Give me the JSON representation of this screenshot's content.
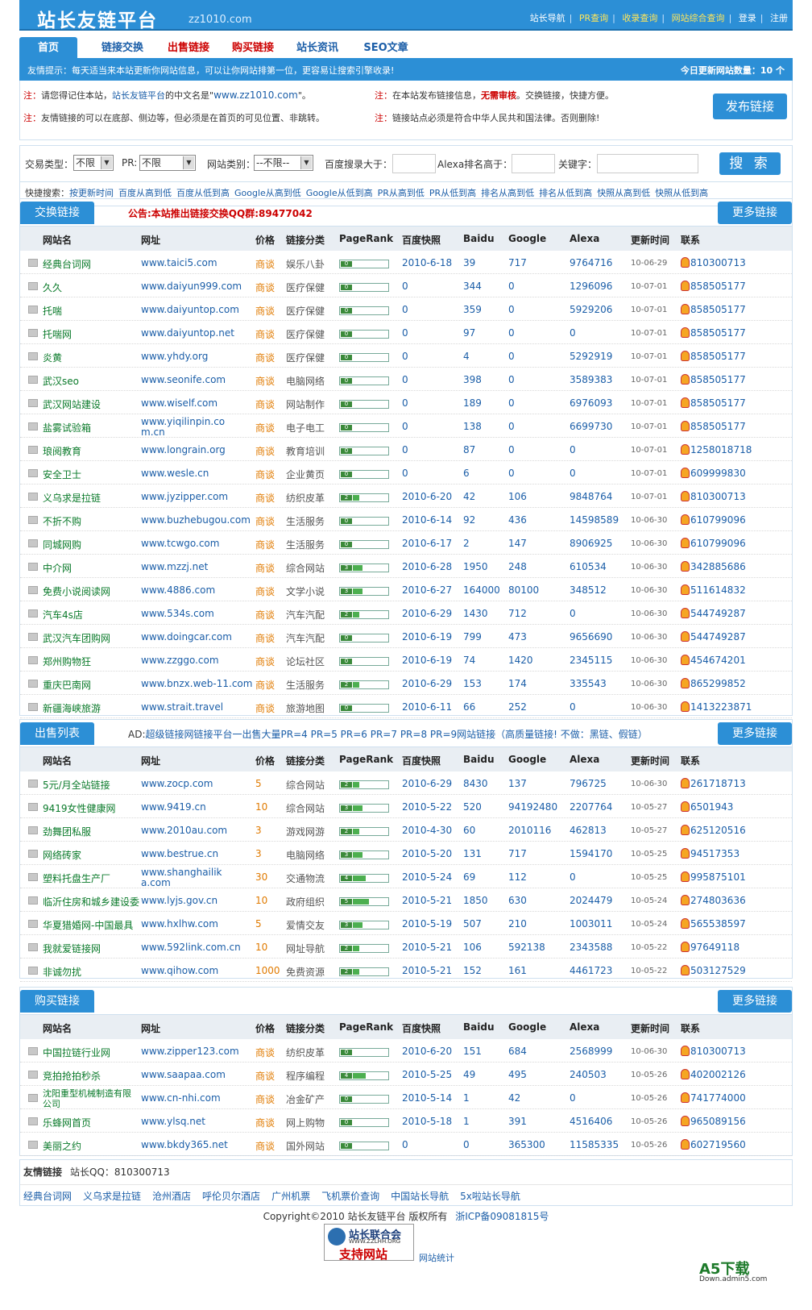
{
  "header": {
    "logo": "站长友链平台",
    "domain": "zz1010.com",
    "links": [
      "站长导航",
      "PR查询",
      "收录查询",
      "网站综合查询",
      "登录",
      "注册"
    ]
  },
  "nav": [
    "首页",
    "链接交换",
    "出售链接",
    "购买链接",
    "站长资讯",
    "SEO文章"
  ],
  "tip": {
    "text": "友情提示：每天适当来本站更新你网站信息，可以让你网站排第一位，更容易让搜索引擎收录!",
    "count": "今日更新网站数量：10 个"
  },
  "notes": {
    "n1a": "注：",
    "n1b": "请您得记住本站，",
    "n1c": "站长友链平台",
    "n1d": "的中文名是\"",
    "n1e": "www.zz1010.com",
    "n1f": "\"。",
    "n2a": "注：",
    "n2b": "友情链接的可以在底部、侧边等，但必须是在首页的可见位置、非跳转。",
    "n3a": "注：",
    "n3b": "在本站发布链接信息，",
    "n3c": "无需审核",
    "n3d": "。交换链接，快捷方便。",
    "n4a": "注：",
    "n4b": "链接站点必须是符合中华人民共和国法律。否则删除!",
    "publish": "发布链接"
  },
  "search": {
    "type_label": "交易类型：",
    "type_val": "不限",
    "pr_label": "PR:",
    "pr_val": "不限",
    "cat_label": "网站类别：",
    "cat_val": "--不限--",
    "baidu_label": "百度搜录大于：",
    "alexa_label": "Alexa排名高于：",
    "kw_label": "关键字：",
    "btn": "搜 索"
  },
  "quick": {
    "label": "快捷搜索：",
    "items": [
      "按更新时间",
      "百度从高到低",
      "百度从低到高",
      "Google从高到低",
      "Google从低到高",
      "PR从高到低",
      "PR从低到高",
      "排名从高到低",
      "排名从低到高",
      "快照从高到低",
      "快照从低到高"
    ]
  },
  "cols": [
    "网站名",
    "网址",
    "价格",
    "链接分类",
    "PageRank",
    "百度快照",
    "Baidu",
    "Google",
    "Alexa",
    "更新时间",
    "联系"
  ],
  "more": "更多链接",
  "exchange": {
    "title": "交换链接",
    "notice": "公告:本站推出链接交换QQ群:89477042",
    "rows": [
      [
        "经典台词网",
        "www.taici5.com",
        "商谈",
        "娱乐八卦",
        "0",
        "2010-6-18",
        "39",
        "717",
        "9764716",
        "10-06-29",
        "810300713"
      ],
      [
        "久久",
        "www.daiyun999.com",
        "商谈",
        "医疗保健",
        "0",
        "0",
        "344",
        "0",
        "1296096",
        "10-07-01",
        "858505177"
      ],
      [
        "托喘",
        "www.daiyuntop.com",
        "商谈",
        "医疗保健",
        "0",
        "0",
        "359",
        "0",
        "5929206",
        "10-07-01",
        "858505177"
      ],
      [
        "托喘网",
        "www.daiyuntop.net",
        "商谈",
        "医疗保健",
        "0",
        "0",
        "97",
        "0",
        "0",
        "10-07-01",
        "858505177"
      ],
      [
        "炎黄",
        "www.yhdy.org",
        "商谈",
        "医疗保健",
        "0",
        "0",
        "4",
        "0",
        "5292919",
        "10-07-01",
        "858505177"
      ],
      [
        "武汉seo",
        "www.seonife.com",
        "商谈",
        "电脑网络",
        "0",
        "0",
        "398",
        "0",
        "3589383",
        "10-07-01",
        "858505177"
      ],
      [
        "武汉网站建设",
        "www.wiself.com",
        "商谈",
        "网站制作",
        "0",
        "0",
        "189",
        "0",
        "6976093",
        "10-07-01",
        "858505177"
      ],
      [
        "盐雾试验箱",
        "www.yiqilinpin.com.cn",
        "商谈",
        "电子电工",
        "0",
        "0",
        "138",
        "0",
        "6699730",
        "10-07-01",
        "858505177"
      ],
      [
        "琅阅教育",
        "www.longrain.org",
        "商谈",
        "教育培训",
        "0",
        "0",
        "87",
        "0",
        "0",
        "10-07-01",
        "1258018718"
      ],
      [
        "安全卫士",
        "www.wesle.cn",
        "商谈",
        "企业黄页",
        "0",
        "0",
        "6",
        "0",
        "0",
        "10-07-01",
        "609999830"
      ],
      [
        "义乌求是拉链",
        "www.jyzipper.com",
        "商谈",
        "纺织皮革",
        "2",
        "2010-6-20",
        "42",
        "106",
        "9848764",
        "10-07-01",
        "810300713"
      ],
      [
        "不折不购",
        "www.buzhebugou.com",
        "商谈",
        "生活服务",
        "0",
        "2010-6-14",
        "92",
        "436",
        "14598589",
        "10-06-30",
        "610799096"
      ],
      [
        "同城网购",
        "www.tcwgo.com",
        "商谈",
        "生活服务",
        "0",
        "2010-6-17",
        "2",
        "147",
        "8906925",
        "10-06-30",
        "610799096"
      ],
      [
        "中介网",
        "www.mzzj.net",
        "商谈",
        "综合网站",
        "3",
        "2010-6-28",
        "1950",
        "248",
        "610534",
        "10-06-30",
        "342885686"
      ],
      [
        "免费小说阅读网",
        "www.4886.com",
        "商谈",
        "文学小说",
        "3",
        "2010-6-27",
        "164000",
        "80100",
        "348512",
        "10-06-30",
        "511614832"
      ],
      [
        "汽车4s店",
        "www.534s.com",
        "商谈",
        "汽车汽配",
        "2",
        "2010-6-29",
        "1430",
        "712",
        "0",
        "10-06-30",
        "544749287"
      ],
      [
        "武汉汽车团购网",
        "www.doingcar.com",
        "商谈",
        "汽车汽配",
        "0",
        "2010-6-19",
        "799",
        "473",
        "9656690",
        "10-06-30",
        "544749287"
      ],
      [
        "郑州购物狂",
        "www.zzggo.com",
        "商谈",
        "论坛社区",
        "0",
        "2010-6-19",
        "74",
        "1420",
        "2345115",
        "10-06-30",
        "454674201"
      ],
      [
        "重庆巴南网",
        "www.bnzx.web-11.com",
        "商谈",
        "生活服务",
        "2",
        "2010-6-29",
        "153",
        "174",
        "335543",
        "10-06-30",
        "865299852"
      ],
      [
        "新疆海峡旅游",
        "www.strait.travel",
        "商谈",
        "旅游地图",
        "0",
        "2010-6-11",
        "66",
        "252",
        "0",
        "10-06-30",
        "1413223871"
      ]
    ]
  },
  "sell": {
    "title": "出售列表",
    "ad_a": "AD:",
    "ad_b": "超级链接网链接平台一出售大量PR=4 PR=5 PR=6 PR=7 PR=8 PR=9网站链接（高质量链接! 不做：黑链、假链）",
    "rows": [
      [
        "5元/月全站链接",
        "www.zocp.com",
        "5",
        "综合网站",
        "2",
        "2010-6-29",
        "8430",
        "137",
        "796725",
        "10-06-30",
        "261718713"
      ],
      [
        "9419女性健康网",
        "www.9419.cn",
        "10",
        "综合网站",
        "3",
        "2010-5-22",
        "520",
        "94192480",
        "2207764",
        "10-05-27",
        "6501943"
      ],
      [
        "劲舞团私服",
        "www.2010au.com",
        "3",
        "游戏网游",
        "2",
        "2010-4-30",
        "60",
        "2010116",
        "462813",
        "10-05-27",
        "625120516"
      ],
      [
        "网络砖家",
        "www.bestrue.cn",
        "3",
        "电脑网络",
        "3",
        "2010-5-20",
        "131",
        "717",
        "1594170",
        "10-05-25",
        "94517353"
      ],
      [
        "塑料托盘生产厂",
        "www.shanghailika.com",
        "30",
        "交通物流",
        "4",
        "2010-5-24",
        "69",
        "112",
        "0",
        "10-05-25",
        "995875101"
      ],
      [
        "临沂住房和城乡建设委",
        "www.lyjs.gov.cn",
        "10",
        "政府组织",
        "5",
        "2010-5-21",
        "1850",
        "630",
        "2024479",
        "10-05-24",
        "274803636"
      ],
      [
        "华夏猎婚网-中国最具",
        "www.hxlhw.com",
        "5",
        "爱情交友",
        "3",
        "2010-5-19",
        "507",
        "210",
        "1003011",
        "10-05-24",
        "565538597"
      ],
      [
        "我就爱链接网",
        "www.592link.com.cn",
        "10",
        "网址导航",
        "2",
        "2010-5-21",
        "106",
        "592138",
        "2343588",
        "10-05-22",
        "97649118"
      ],
      [
        "非诚勿扰",
        "www.qihow.com",
        "1000",
        "免费资源",
        "2",
        "2010-5-21",
        "152",
        "161",
        "4461723",
        "10-05-22",
        "503127529"
      ]
    ]
  },
  "buy": {
    "title": "购买链接",
    "rows": [
      [
        "中国拉链行业网",
        "www.zipper123.com",
        "商谈",
        "纺织皮革",
        "0",
        "2010-6-20",
        "151",
        "684",
        "2568999",
        "10-06-30",
        "810300713"
      ],
      [
        "竞拍抢拍秒杀",
        "www.saapaa.com",
        "商谈",
        "程序编程",
        "4",
        "2010-5-25",
        "49",
        "495",
        "240503",
        "10-05-26",
        "402002126"
      ],
      [
        "沈阳重型机械制造有限公司",
        "www.cn-nhi.com",
        "商谈",
        "冶金矿产",
        "0",
        "2010-5-14",
        "1",
        "42",
        "0",
        "10-05-26",
        "741774000"
      ],
      [
        "乐蜂网首页",
        "www.ylsq.net",
        "商谈",
        "网上购物",
        "0",
        "2010-5-18",
        "1",
        "391",
        "4516406",
        "10-05-26",
        "965089156"
      ],
      [
        "美丽之约",
        "www.bkdy365.net",
        "商谈",
        "国外网站",
        "0",
        "0",
        "0",
        "365300",
        "11585335",
        "10-05-26",
        "602719560"
      ]
    ]
  },
  "friends": {
    "title": "友情链接",
    "qq": "站长QQ：810300713",
    "links": [
      "经典台词网",
      "义乌求是拉链",
      "沧州酒店",
      "呼伦贝尔酒店",
      "广州机票",
      "飞机票价查询",
      "中国站长导航",
      "5x啦站长导航"
    ]
  },
  "footer": {
    "copy": "Copyright©2010 站长友链平台  版权所有",
    "icp": "浙ICP备09081815号",
    "badge1": "站长联合会",
    "badge2": "WWW.ZZLHH.ORG",
    "badge3": "支持网站",
    "stat": "网站统计",
    "wm": "A5下载",
    "wm2": "Down.admin5.com"
  }
}
